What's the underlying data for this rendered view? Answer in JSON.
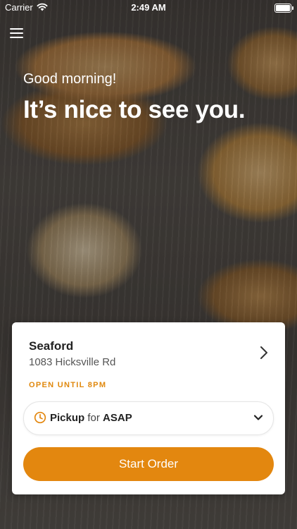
{
  "status_bar": {
    "carrier": "Carrier",
    "time": "2:49 AM"
  },
  "hero": {
    "greeting": "Good morning!",
    "headline": "It’s nice to see you."
  },
  "store": {
    "name": "Seaford",
    "address": "1083 Hicksville Rd",
    "hours": "OPEN UNTIL 8PM"
  },
  "order_mode": {
    "mode": "Pickup",
    "connector": "for",
    "time": "ASAP"
  },
  "actions": {
    "start_order_label": "Start Order"
  },
  "colors": {
    "accent": "#e3870f",
    "hours_text": "#e0880d"
  },
  "icons": [
    "menu-icon",
    "wifi-icon",
    "battery-icon",
    "chevron-right-icon",
    "clock-icon",
    "chevron-down-icon"
  ]
}
